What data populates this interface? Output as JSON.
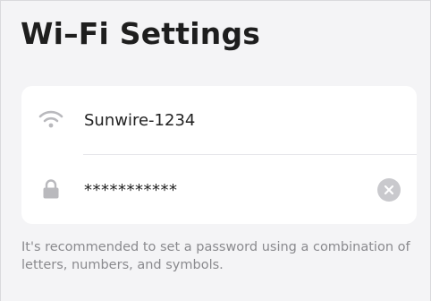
{
  "header": {
    "title": "Wi–Fi Settings"
  },
  "network": {
    "ssid": "Sunwire-1234",
    "ssid_icon": "wifi-icon",
    "password": "***********",
    "password_icon": "lock-icon",
    "clear_icon": "clear-icon"
  },
  "hint": {
    "text": "It's recommended to set a password using a combination of letters, numbers, and symbols."
  },
  "colors": {
    "background": "#f4f4f6",
    "card": "#ffffff",
    "icon_gray": "#b9b9bd",
    "clear_button": "#c9c9cd",
    "hint_text": "#8a8a8e"
  }
}
